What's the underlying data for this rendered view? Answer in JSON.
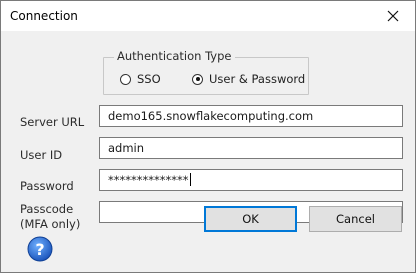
{
  "window": {
    "title": "Connection"
  },
  "auth": {
    "legend": "Authentication Type",
    "options": [
      {
        "label": "SSO",
        "selected": false
      },
      {
        "label": "User & Password",
        "selected": true
      }
    ]
  },
  "fields": {
    "server_url": {
      "label": "Server URL",
      "value": "demo165.snowflakecomputing.com"
    },
    "user_id": {
      "label": "User ID",
      "value": "admin"
    },
    "password": {
      "label": "Password",
      "value": "**************"
    },
    "passcode": {
      "label_line1": "Passcode",
      "label_line2": "(MFA only)",
      "value": ""
    }
  },
  "buttons": {
    "ok": "OK",
    "cancel": "Cancel"
  },
  "icons": {
    "close": "close-icon",
    "help": "help-icon"
  },
  "colors": {
    "focus_border": "#0078d7",
    "help_blue": "#1f6ed4"
  }
}
